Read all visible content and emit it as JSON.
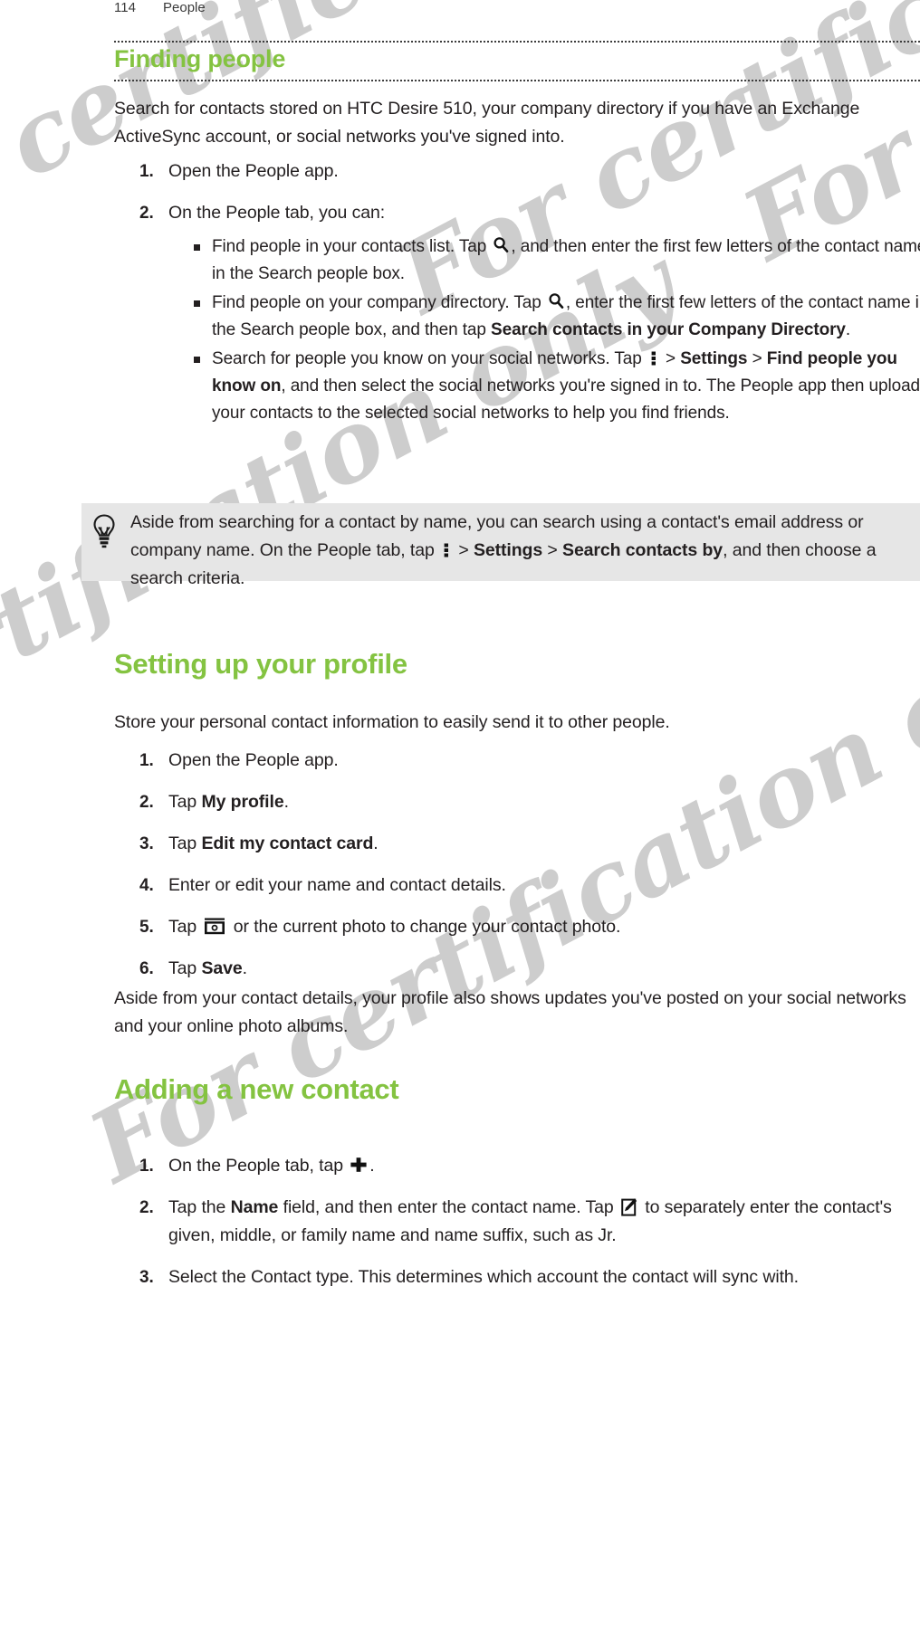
{
  "page": {
    "number": "114",
    "chapter": "People",
    "accent_color": "#84c341",
    "text_color": "#231f20",
    "tipbox_bg": "#e6e6e6",
    "watermark_text": "For certification only"
  },
  "chapter_title": "Finding people",
  "intro_paragraph": "Search for contacts stored on HTC Desire 510, your company directory if you have an Exchange ActiveSync account, or social networks you've signed into.",
  "finding_steps": [
    {
      "num": "1.",
      "text": "Open the People app."
    },
    {
      "num": "2.",
      "text": "On the People tab, you can:"
    }
  ],
  "finding_bullets": [
    {
      "pre": "Find people in your contacts list. Tap ",
      "icon": "search-icon",
      "post": ", and then enter the first few letters of the contact name in the Search people box."
    },
    {
      "pre": "Find people on your company directory. Tap ",
      "icon": "search-icon",
      "mid": ", enter the first few letters of the contact name in the Search people box, and then tap ",
      "bold": "Search contacts in your Company Directory",
      "post": "."
    },
    {
      "pre": "Search for people you know on your social networks. Tap ",
      "icon": "kebab-menu-icon",
      "mid": " > ",
      "bold1": "Settings",
      "mid2": " > ",
      "bold2": "Find people you know on",
      "post": ", and then select the social networks you're signed in to. The People app then uploads your contacts to the selected social networks to help you find friends."
    }
  ],
  "tip": {
    "icon": "lightbulb-icon",
    "pre": "Aside from searching for a contact by name, you can search using a contact's email address or company name. On the People tab, tap ",
    "icon_inline": "kebab-menu-icon",
    "mid": " > ",
    "bold1": "Settings",
    "mid2": " > ",
    "bold2": "Search contacts by",
    "post": ", and then choose a search criteria."
  },
  "section_profile": {
    "heading": "Setting up your profile",
    "paragraph": "Store your personal contact information to easily send it to other people.",
    "steps": [
      {
        "num": "1.",
        "text": "Open the People app."
      },
      {
        "num": "2.",
        "pre": "Tap ",
        "bold": "My profile",
        "post": "."
      },
      {
        "num": "3.",
        "pre": "Tap ",
        "bold": "Edit my contact card",
        "post": "."
      },
      {
        "num": "4.",
        "text": "Enter or edit your name and contact details."
      },
      {
        "num": "5.",
        "pre": "Tap ",
        "icon": "camera-icon",
        "post": " or the current photo to change your contact photo."
      },
      {
        "num": "6.",
        "pre": "Tap ",
        "bold": "Save",
        "post": "."
      }
    ],
    "after_paragraph": "Aside from your contact details, your profile also shows updates you've posted on your social networks and your online photo albums."
  },
  "section_adding": {
    "heading": "Adding a new contact",
    "steps": [
      {
        "num": "1.",
        "pre": "On the People tab, tap ",
        "icon": "plus-icon",
        "post": "."
      },
      {
        "num": "2.",
        "pre": "Tap the ",
        "bold": "Name",
        "mid": " field, and then enter the contact name. Tap ",
        "icon": "pencil-edit-icon",
        "post": " to separately enter the contact's given, middle, or family name and name suffix, such as Jr."
      },
      {
        "num": "3.",
        "text": "Select the Contact type. This determines which account the contact will sync with."
      }
    ]
  }
}
